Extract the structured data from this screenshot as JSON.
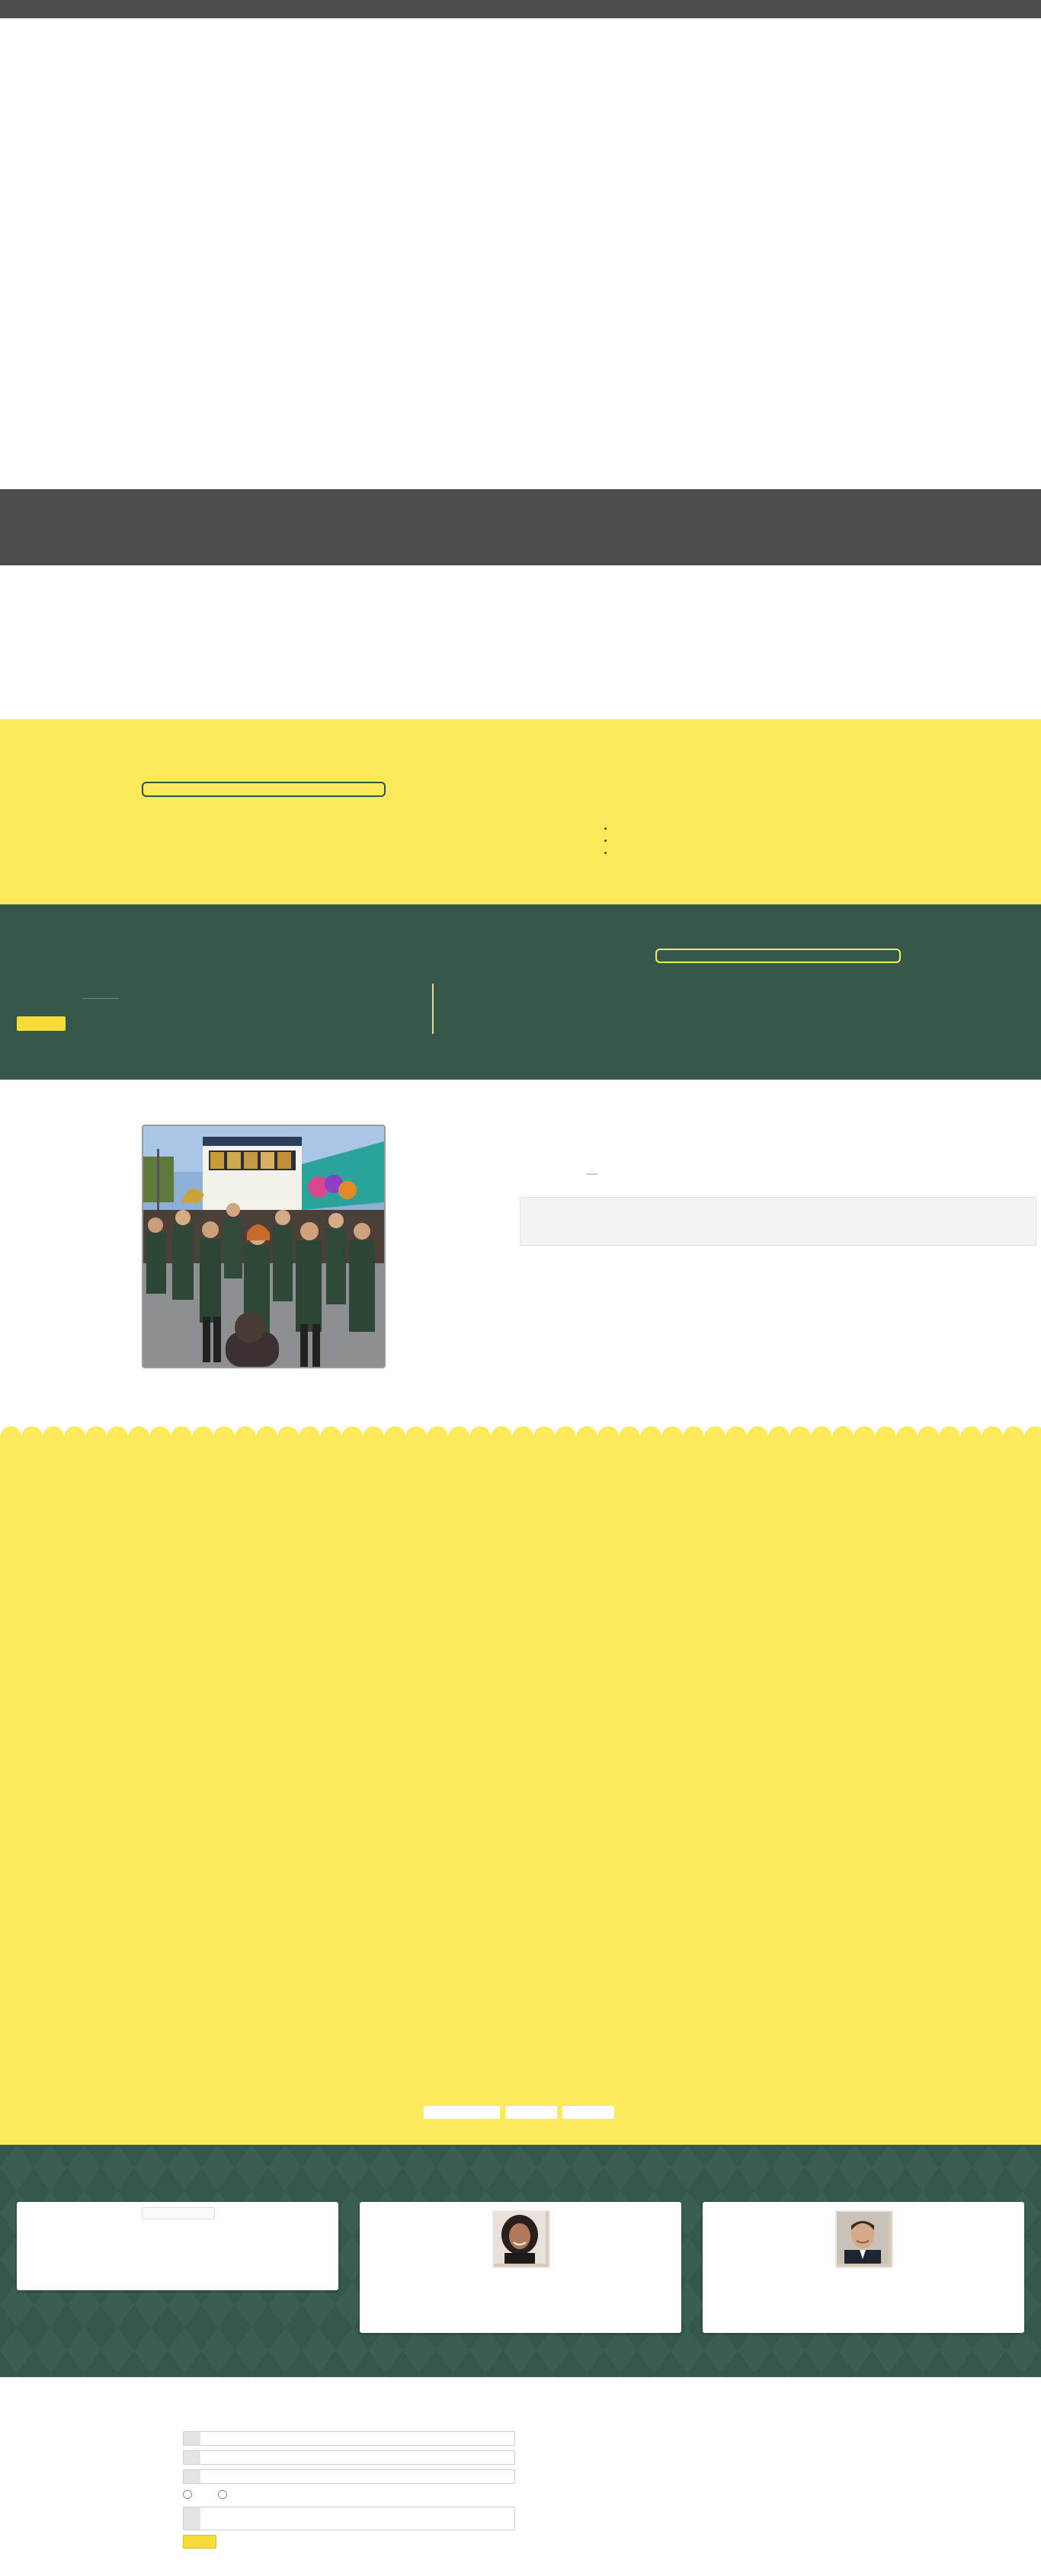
{
  "colors": {
    "dark_grey": "#4e4e4e",
    "yellow": "#fde95c",
    "button_yellow": "#f6dc38",
    "green": "#35584a",
    "white": "#ffffff"
  },
  "navigation": {
    "tabs": [
      "",
      "",
      ""
    ]
  },
  "icons": [
    "more-vertical-icon",
    "avatar-photo",
    "band-photo"
  ],
  "form": {
    "fields": [
      "",
      "",
      ""
    ],
    "radio_options": [
      "",
      ""
    ],
    "message_placeholder": "",
    "submit_label": ""
  }
}
